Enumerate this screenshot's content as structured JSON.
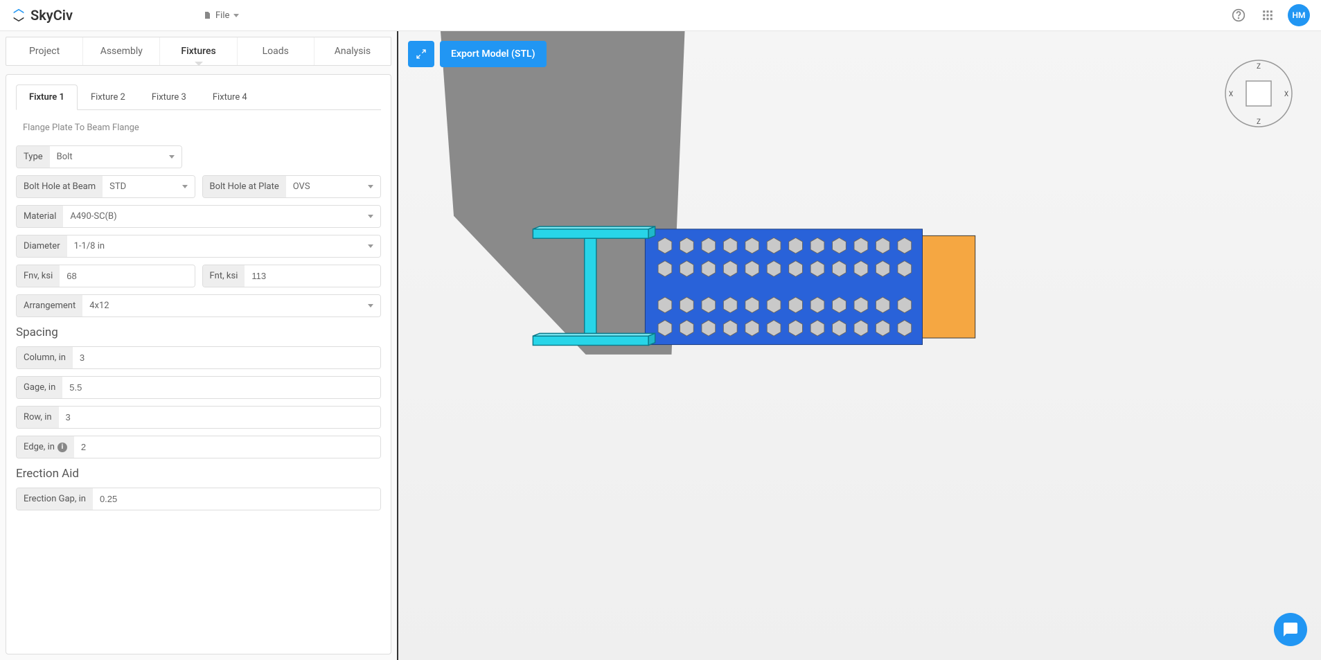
{
  "brand": "SkyCiv",
  "file_menu": {
    "label": "File"
  },
  "user": {
    "initials": "HM"
  },
  "main_tabs": [
    "Project",
    "Assembly",
    "Fixtures",
    "Loads",
    "Analysis"
  ],
  "active_main_tab": 2,
  "sub_tabs": [
    "Fixture 1",
    "Fixture 2",
    "Fixture 3",
    "Fixture 4"
  ],
  "active_sub_tab": 0,
  "fixture": {
    "description": "Flange Plate To Beam Flange",
    "type_label": "Type",
    "type_value": "Bolt",
    "bolt_hole_beam_label": "Bolt Hole at Beam",
    "bolt_hole_beam_value": "STD",
    "bolt_hole_plate_label": "Bolt Hole at Plate",
    "bolt_hole_plate_value": "OVS",
    "material_label": "Material",
    "material_value": "A490-SC(B)",
    "diameter_label": "Diameter",
    "diameter_value": "1-1/8 in",
    "fnv_label": "Fnv, ksi",
    "fnv_value": "68",
    "fnt_label": "Fnt, ksi",
    "fnt_value": "113",
    "arrangement_label": "Arrangement",
    "arrangement_value": "4x12"
  },
  "spacing": {
    "title": "Spacing",
    "column_label": "Column, in",
    "column_value": "3",
    "gage_label": "Gage, in",
    "gage_value": "5.5",
    "row_label": "Row, in",
    "row_value": "3",
    "edge_label": "Edge, in",
    "edge_value": "2"
  },
  "erection": {
    "title": "Erection Aid",
    "gap_label": "Erection Gap, in",
    "gap_value": "0.25"
  },
  "viewport": {
    "export_label": "Export Model (STL)",
    "axes": {
      "top": "Z",
      "bottom": "Z",
      "left": "X",
      "right": "X"
    }
  },
  "colors": {
    "primary": "#2196f3",
    "column": "#28d5e8",
    "plate": "#2962d9",
    "beam": "#f5a742",
    "bolt": "#c9c9c9",
    "shadow": "#8a8a8a"
  }
}
